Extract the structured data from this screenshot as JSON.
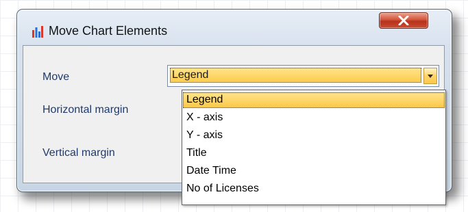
{
  "dialog": {
    "title": "Move Chart Elements",
    "close_symbol": "X",
    "icon": "bar-chart-icon"
  },
  "form": {
    "move_label": "Move",
    "horizontal_margin_label": "Horizontal margin",
    "vertical_margin_label": "Vertical margin"
  },
  "combo": {
    "selected": "Legend",
    "options": [
      "Legend",
      "X - axis",
      "Y - axis",
      "Title",
      "Date Time",
      "No of Licenses"
    ]
  },
  "colors": {
    "highlight": "#fcc94a",
    "close_button": "#c94a2f",
    "label_text": "#1f3a6b"
  }
}
